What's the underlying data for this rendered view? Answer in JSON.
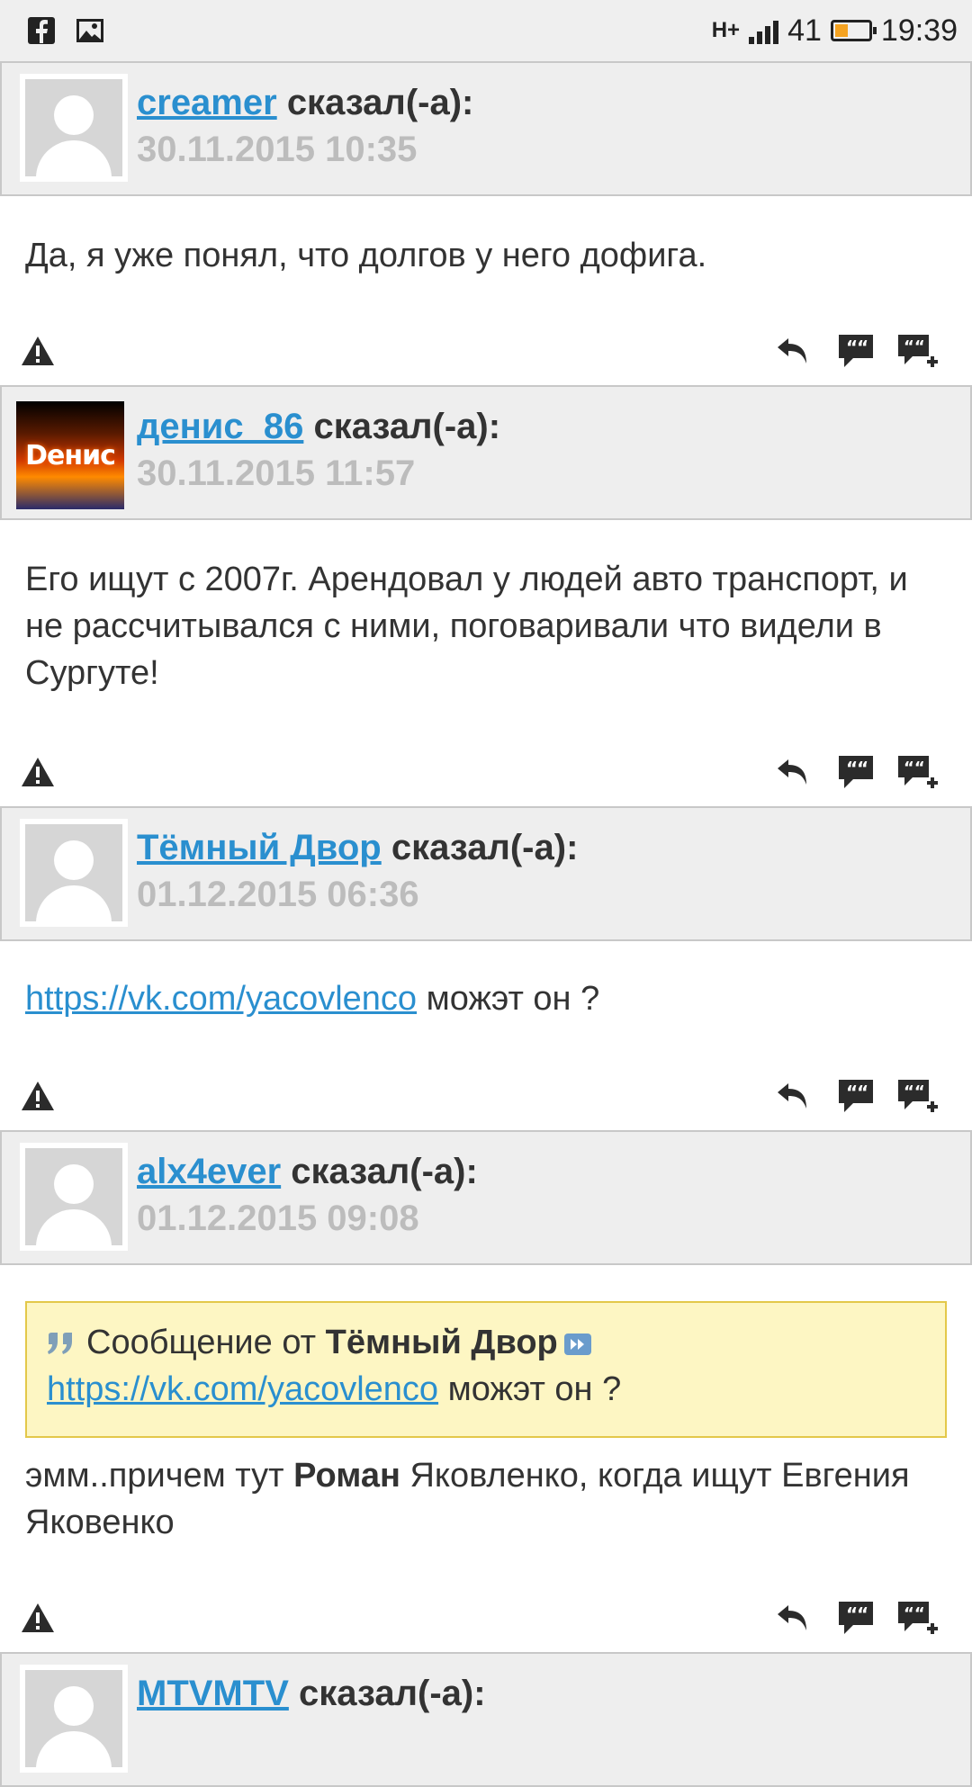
{
  "status_bar": {
    "network": "H+",
    "signal_text": "41",
    "battery_level": 0.35,
    "time": "19:39",
    "icons": [
      "facebook-icon",
      "image-icon"
    ]
  },
  "posts": [
    {
      "author": "creamer",
      "said": "сказал(-а):",
      "date": "30.11.2015 10:35",
      "avatar": "default",
      "body": "Да, я уже понял, что долгов у него дофига."
    },
    {
      "author": "денис_86",
      "said": "сказал(-а):",
      "date": "30.11.2015 11:57",
      "avatar": "custom",
      "avatar_text": "Dенис",
      "body": "Его ищут с 2007г. Арендовал у людей авто транспорт, и не рассчитывался с ними, поговаривали что видели в Сургуте!"
    },
    {
      "author": "Тёмный Двор",
      "said": "сказал(-а):",
      "date": "01.12.2015 06:36",
      "avatar": "default",
      "body_link": "https://vk.com/yacovlenco",
      "body_rest": " можэт он ?"
    },
    {
      "author": "alx4ever",
      "said": "сказал(-а):",
      "date": "01.12.2015 09:08",
      "avatar": "default",
      "quote": {
        "prefix": "Сообщение от ",
        "author": "Тёмный Двор",
        "link": "https://vk.com/yacovlenco",
        "rest": " можэт он ?"
      },
      "body_part1": "эмм..причем тут ",
      "body_bold": "Роман",
      "body_part2": " Яковленко, когда ищут Евгения Яковенко"
    },
    {
      "author": "MTVMTV",
      "said": "сказал(-а):",
      "avatar": "default"
    }
  ],
  "colors": {
    "link": "#2a8fcf",
    "header_bg": "#eeeeee",
    "date": "#bcbcbc",
    "quote_bg": "#fdf6c3",
    "quote_border": "#e3c84a",
    "battery": "#f5a321"
  }
}
